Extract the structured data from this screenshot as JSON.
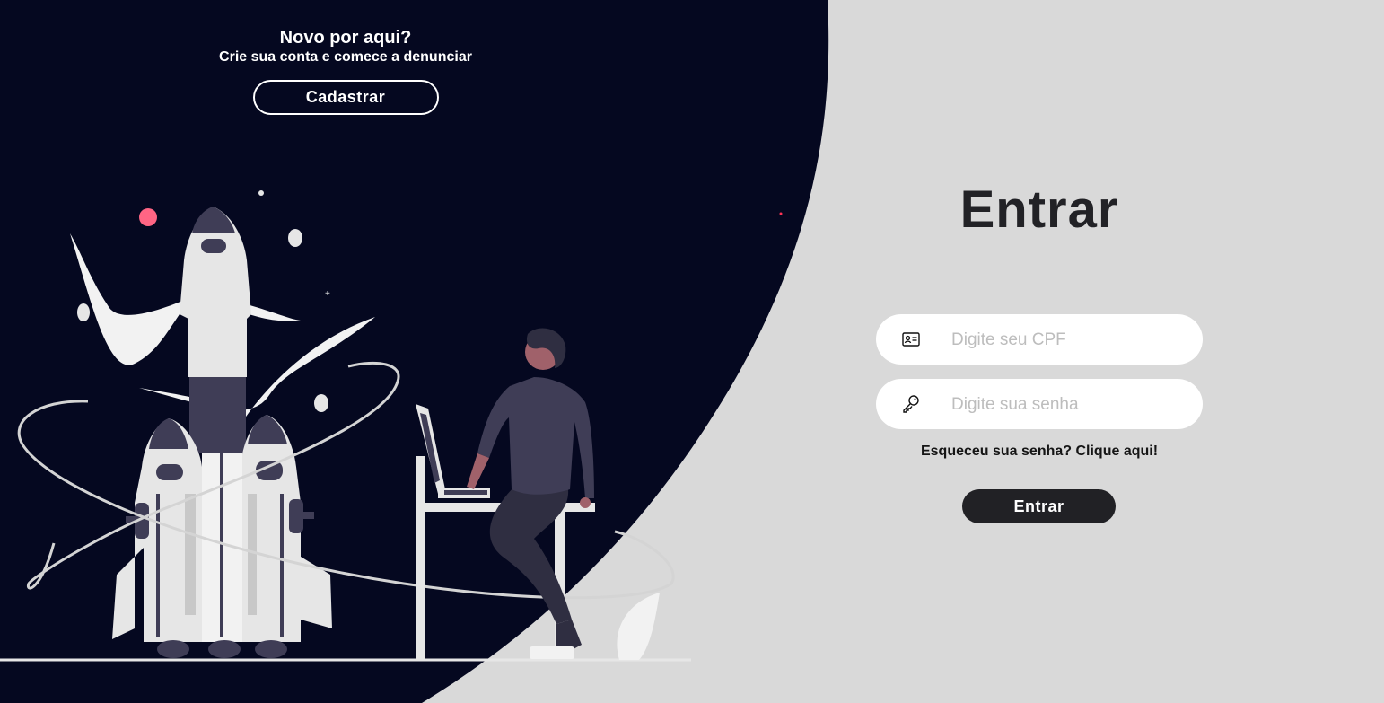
{
  "signup": {
    "title": "Novo por aqui?",
    "subtitle": "Crie sua conta e comece a denunciar",
    "button_label": "Cadastrar"
  },
  "login": {
    "title": "Entrar",
    "cpf_placeholder": "Digite seu CPF",
    "cpf_icon": "id-card-icon",
    "password_placeholder": "Digite sua senha",
    "password_icon": "key-icon",
    "forgot_link": "Esqueceu sua senha? Clique aqui!",
    "button_label": "Entrar"
  },
  "colors": {
    "dark_panel": "#050820",
    "light_bg": "#d9d9d9",
    "button_dark": "#212125",
    "accent_pink": "#ff6584",
    "figure_purple": "#3f3d56"
  },
  "illustration": "rocket-launch-illustration"
}
